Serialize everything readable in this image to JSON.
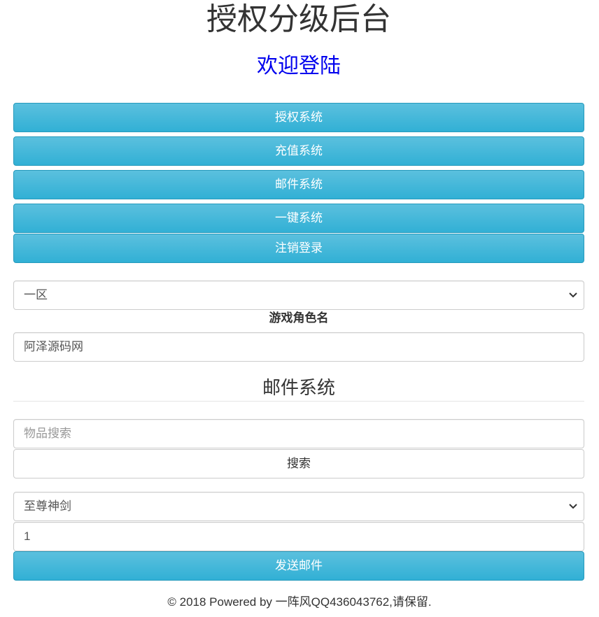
{
  "header": {
    "title": "授权分级后台",
    "subtitle": "欢迎登陆"
  },
  "nav": {
    "items": [
      {
        "label": "授权系统"
      },
      {
        "label": "充值系统"
      },
      {
        "label": "邮件系统"
      },
      {
        "label": "一键系统"
      },
      {
        "label": "注销登录"
      }
    ]
  },
  "form": {
    "server_select": {
      "value": "一区"
    },
    "role_label": "游戏角色名",
    "role_input": {
      "value": "阿泽源码网"
    }
  },
  "mail": {
    "section_title": "邮件系统",
    "search_input": {
      "placeholder": "物品搜索",
      "value": ""
    },
    "search_button": "搜索",
    "item_select": {
      "value": "至尊神剑"
    },
    "quantity_input": {
      "value": "1"
    },
    "send_button": "发送邮件"
  },
  "footer": {
    "text": "© 2018 Powered by 一阵风QQ436043762,请保留."
  },
  "colors": {
    "accent": "#5bc0de",
    "accent_dark": "#31b0d5",
    "subtitle": "#0000ee"
  }
}
